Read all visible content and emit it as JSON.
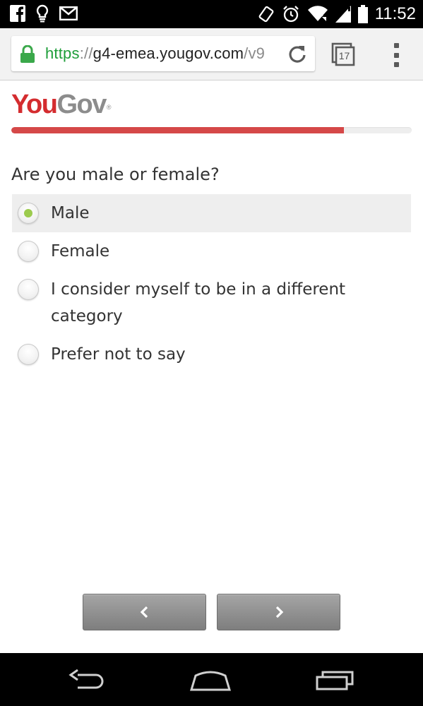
{
  "status_bar": {
    "time": "11:52",
    "left_icons": [
      "facebook-icon",
      "notification-bulb-icon",
      "gmail-icon"
    ],
    "right_icons": [
      "vibrate-icon",
      "alarm-icon",
      "wifi-icon",
      "signal-icon",
      "battery-icon"
    ]
  },
  "browser": {
    "url_scheme": "https",
    "url_separator": "://",
    "url_host": "g4-emea.yougov.com",
    "url_path": "/v9",
    "tab_count": "17",
    "colors": {
      "secure": "#1e9e3a"
    }
  },
  "logo": {
    "you": "YouGov",
    "part_you": "You",
    "part_gov": "Gov",
    "reg_mark": "®"
  },
  "survey": {
    "progress": 0.83,
    "question": "Are you male or female?",
    "options": [
      {
        "label": "Male",
        "selected": true
      },
      {
        "label": "Female",
        "selected": false
      },
      {
        "label": "I consider myself to be in a different category",
        "selected": false
      },
      {
        "label": "Prefer not to say",
        "selected": false
      }
    ],
    "colors": {
      "progress": "#d54848",
      "selected_dot": "#9ccb4e",
      "brand_red": "#d42c2f"
    }
  },
  "nav": {
    "back_icon": "chevron-left-icon",
    "next_icon": "chevron-right-icon"
  },
  "system_nav": [
    "back-icon",
    "home-icon",
    "recents-icon"
  ]
}
